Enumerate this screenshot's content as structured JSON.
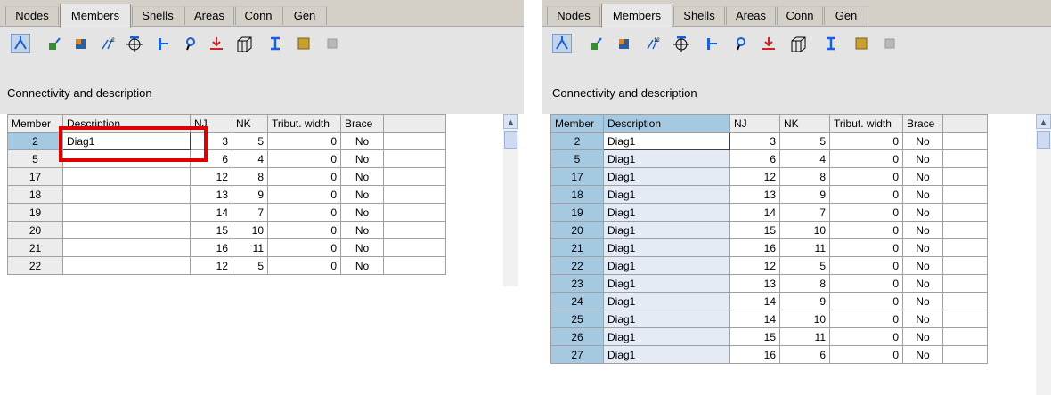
{
  "tabs": [
    "Nodes",
    "Members",
    "Shells",
    "Areas",
    "Conn",
    "Gen"
  ],
  "active_tab": "Members",
  "toolbar_icons": [
    "member-connect-icon",
    "release-icon",
    "section-icon",
    "local-axes-icon",
    "member-offset-icon",
    "rigid-end-icon",
    "hinge-icon",
    "load-icon",
    "frame-3d-icon",
    "i-beam-icon",
    "material-icon",
    "disabled-icon"
  ],
  "section_title": "Connectivity and description",
  "columns": [
    "Member",
    "Description",
    "NJ",
    "NK",
    "Tribut. width",
    "Brace"
  ],
  "left_rows": [
    {
      "member": "2",
      "desc": "Diag1",
      "nj": "3",
      "nk": "5",
      "tw": "0",
      "brace": "No"
    },
    {
      "member": "5",
      "desc": "",
      "nj": "6",
      "nk": "4",
      "tw": "0",
      "brace": "No"
    },
    {
      "member": "17",
      "desc": "",
      "nj": "12",
      "nk": "8",
      "tw": "0",
      "brace": "No"
    },
    {
      "member": "18",
      "desc": "",
      "nj": "13",
      "nk": "9",
      "tw": "0",
      "brace": "No"
    },
    {
      "member": "19",
      "desc": "",
      "nj": "14",
      "nk": "7",
      "tw": "0",
      "brace": "No"
    },
    {
      "member": "20",
      "desc": "",
      "nj": "15",
      "nk": "10",
      "tw": "0",
      "brace": "No"
    },
    {
      "member": "21",
      "desc": "",
      "nj": "16",
      "nk": "11",
      "tw": "0",
      "brace": "No"
    },
    {
      "member": "22",
      "desc": "",
      "nj": "12",
      "nk": "5",
      "tw": "0",
      "brace": "No"
    }
  ],
  "right_rows": [
    {
      "member": "2",
      "desc": "Diag1",
      "nj": "3",
      "nk": "5",
      "tw": "0",
      "brace": "No"
    },
    {
      "member": "5",
      "desc": "Diag1",
      "nj": "6",
      "nk": "4",
      "tw": "0",
      "brace": "No"
    },
    {
      "member": "17",
      "desc": "Diag1",
      "nj": "12",
      "nk": "8",
      "tw": "0",
      "brace": "No"
    },
    {
      "member": "18",
      "desc": "Diag1",
      "nj": "13",
      "nk": "9",
      "tw": "0",
      "brace": "No"
    },
    {
      "member": "19",
      "desc": "Diag1",
      "nj": "14",
      "nk": "7",
      "tw": "0",
      "brace": "No"
    },
    {
      "member": "20",
      "desc": "Diag1",
      "nj": "15",
      "nk": "10",
      "tw": "0",
      "brace": "No"
    },
    {
      "member": "21",
      "desc": "Diag1",
      "nj": "16",
      "nk": "11",
      "tw": "0",
      "brace": "No"
    },
    {
      "member": "22",
      "desc": "Diag1",
      "nj": "12",
      "nk": "5",
      "tw": "0",
      "brace": "No"
    },
    {
      "member": "23",
      "desc": "Diag1",
      "nj": "13",
      "nk": "8",
      "tw": "0",
      "brace": "No"
    },
    {
      "member": "24",
      "desc": "Diag1",
      "nj": "14",
      "nk": "9",
      "tw": "0",
      "brace": "No"
    },
    {
      "member": "25",
      "desc": "Diag1",
      "nj": "14",
      "nk": "10",
      "tw": "0",
      "brace": "No"
    },
    {
      "member": "26",
      "desc": "Diag1",
      "nj": "15",
      "nk": "11",
      "tw": "0",
      "brace": "No"
    },
    {
      "member": "27",
      "desc": "Diag1",
      "nj": "16",
      "nk": "6",
      "tw": "0",
      "brace": "No"
    }
  ],
  "colors": {
    "highlight": "#a6c9e2",
    "annotation": "#e00000",
    "tab_bg": "#d4d0c8"
  }
}
